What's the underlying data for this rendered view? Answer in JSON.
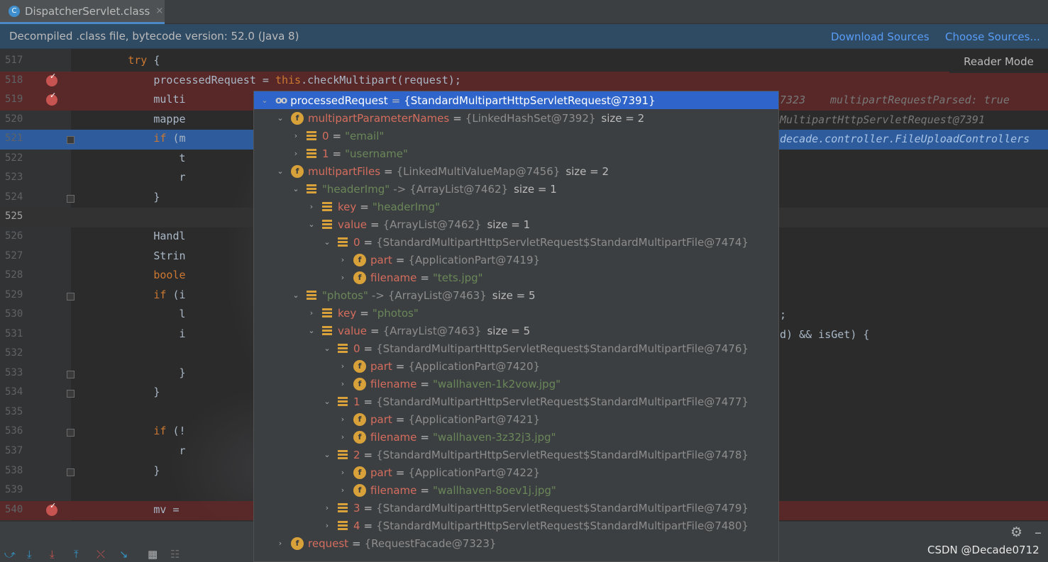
{
  "tab": {
    "title": "DispatcherServlet.class",
    "close": "×",
    "icon": "C"
  },
  "banner": {
    "text": "Decompiled .class file, bytecode version: 52.0 (Java 8)",
    "download_sources": "Download Sources",
    "choose_sources": "Choose Sources..."
  },
  "reader_mode": "Reader Mode",
  "lines": [
    {
      "n": "517",
      "code": "        try {"
    },
    {
      "n": "518",
      "code": "            processedRequest = this.checkMultipart(request);"
    },
    {
      "n": "519",
      "code": "            multi"
    },
    {
      "n": "520",
      "code": "            mappe"
    },
    {
      "n": "521",
      "code": "            if (m"
    },
    {
      "n": "522",
      "code": "                t"
    },
    {
      "n": "523",
      "code": "                r"
    },
    {
      "n": "524",
      "code": "            }"
    },
    {
      "n": "525",
      "code": ""
    },
    {
      "n": "526",
      "code": "            Handl"
    },
    {
      "n": "527",
      "code": "            Strin"
    },
    {
      "n": "528",
      "code": "            boole"
    },
    {
      "n": "529",
      "code": "            if (i"
    },
    {
      "n": "530",
      "code": "                l"
    },
    {
      "n": "531",
      "code": "                i"
    },
    {
      "n": "532",
      "code": ""
    },
    {
      "n": "533",
      "code": "                }"
    },
    {
      "n": "534",
      "code": "            }"
    },
    {
      "n": "535",
      "code": ""
    },
    {
      "n": "536",
      "code": "            if (!"
    },
    {
      "n": "537",
      "code": "                r"
    },
    {
      "n": "538",
      "code": "            }"
    },
    {
      "n": "539",
      "code": ""
    },
    {
      "n": "540",
      "code": "            mv = "
    }
  ],
  "inline_values": {
    "l519a": "7323",
    "l519b": "multipartRequestParsed: true",
    "l520": "MultipartHttpServletRequest@7391",
    "l521": "decade.controller.FileUploadControllers",
    "l530": ";",
    "l531": "d) && isGet) {"
  },
  "tree": [
    {
      "depth": 0,
      "chev": "⌄",
      "icon": "oo",
      "name": "processedRequest",
      "type": "{StandardMultipartHttpServletRequest@7391}",
      "sel": true
    },
    {
      "depth": 1,
      "chev": "⌄",
      "icon": "f",
      "name": "multipartParameterNames",
      "type": "{LinkedHashSet@7392}",
      "size": "size = 2"
    },
    {
      "depth": 2,
      "chev": "›",
      "icon": "lines",
      "name": "0",
      "value": "\"email\""
    },
    {
      "depth": 2,
      "chev": "›",
      "icon": "lines",
      "name": "1",
      "value": "\"username\""
    },
    {
      "depth": 1,
      "chev": "⌄",
      "icon": "f",
      "name": "multipartFiles",
      "type": "{LinkedMultiValueMap@7456}",
      "size": "size = 2"
    },
    {
      "depth": 2,
      "chev": "⌄",
      "icon": "lines",
      "key": "\"headerImg\"",
      "arrow": "->",
      "type": "{ArrayList@7462}",
      "size": "size = 1"
    },
    {
      "depth": 3,
      "chev": "›",
      "icon": "lines",
      "name": "key",
      "value": "\"headerImg\""
    },
    {
      "depth": 3,
      "chev": "⌄",
      "icon": "lines",
      "name": "value",
      "type": "{ArrayList@7462}",
      "size": "size = 1"
    },
    {
      "depth": 4,
      "chev": "⌄",
      "icon": "lines",
      "name": "0",
      "type": "{StandardMultipartHttpServletRequest$StandardMultipartFile@7474}"
    },
    {
      "depth": 5,
      "chev": "›",
      "icon": "f",
      "name": "part",
      "type": "{ApplicationPart@7419}"
    },
    {
      "depth": 5,
      "chev": "›",
      "icon": "f",
      "name": "filename",
      "value": "\"tets.jpg\""
    },
    {
      "depth": 2,
      "chev": "⌄",
      "icon": "lines",
      "key": "\"photos\"",
      "arrow": "->",
      "type": "{ArrayList@7463}",
      "size": "size = 5"
    },
    {
      "depth": 3,
      "chev": "›",
      "icon": "lines",
      "name": "key",
      "value": "\"photos\""
    },
    {
      "depth": 3,
      "chev": "⌄",
      "icon": "lines",
      "name": "value",
      "type": "{ArrayList@7463}",
      "size": "size = 5"
    },
    {
      "depth": 4,
      "chev": "⌄",
      "icon": "lines",
      "name": "0",
      "type": "{StandardMultipartHttpServletRequest$StandardMultipartFile@7476}"
    },
    {
      "depth": 5,
      "chev": "›",
      "icon": "f",
      "name": "part",
      "type": "{ApplicationPart@7420}"
    },
    {
      "depth": 5,
      "chev": "›",
      "icon": "f",
      "name": "filename",
      "value": "\"wallhaven-1k2vow.jpg\""
    },
    {
      "depth": 4,
      "chev": "⌄",
      "icon": "lines",
      "name": "1",
      "type": "{StandardMultipartHttpServletRequest$StandardMultipartFile@7477}"
    },
    {
      "depth": 5,
      "chev": "›",
      "icon": "f",
      "name": "part",
      "type": "{ApplicationPart@7421}"
    },
    {
      "depth": 5,
      "chev": "›",
      "icon": "f",
      "name": "filename",
      "value": "\"wallhaven-3z32j3.jpg\""
    },
    {
      "depth": 4,
      "chev": "⌄",
      "icon": "lines",
      "name": "2",
      "type": "{StandardMultipartHttpServletRequest$StandardMultipartFile@7478}"
    },
    {
      "depth": 5,
      "chev": "›",
      "icon": "f",
      "name": "part",
      "type": "{ApplicationPart@7422}"
    },
    {
      "depth": 5,
      "chev": "›",
      "icon": "f",
      "name": "filename",
      "value": "\"wallhaven-8oev1j.jpg\""
    },
    {
      "depth": 4,
      "chev": "›",
      "icon": "lines",
      "name": "3",
      "type": "{StandardMultipartHttpServletRequest$StandardMultipartFile@7479}"
    },
    {
      "depth": 4,
      "chev": "›",
      "icon": "lines",
      "name": "4",
      "type": "{StandardMultipartHttpServletRequest$StandardMultipartFile@7480}"
    },
    {
      "depth": 1,
      "chev": "›",
      "icon": "f",
      "name": "request",
      "type": "{RequestFacade@7323}"
    }
  ],
  "watermark": "CSDN @Decade0712",
  "colors": {
    "accent": "#2f65ca",
    "breakpoint": "#c75450",
    "field_icon": "#d8a13a",
    "string": "#6a8759",
    "field_name": "#d56d5e"
  }
}
